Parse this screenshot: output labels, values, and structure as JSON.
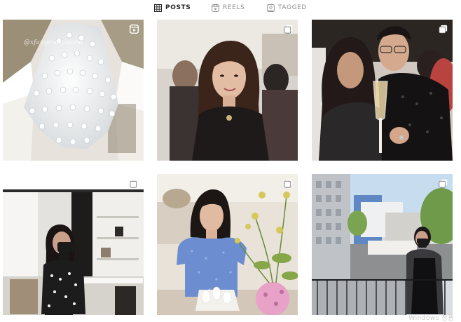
{
  "tabs": [
    {
      "label": "POSTS",
      "icon": "grid-icon",
      "active": true
    },
    {
      "label": "REELS",
      "icon": "reels-icon",
      "active": false
    },
    {
      "label": "TAGGED",
      "icon": "tagged-icon",
      "active": false
    }
  ],
  "posts": [
    {
      "type": "reel",
      "badge_icon": "reels-icon",
      "scene": "crystal chandelier"
    },
    {
      "type": "carousel",
      "badge_icon": "carousel-icon",
      "scene": "woman at event"
    },
    {
      "type": "carousel",
      "badge_icon": "carousel-icon",
      "scene": "couple with champagne"
    },
    {
      "type": "carousel",
      "badge_icon": "carousel-icon",
      "scene": "boutique mirror selfie"
    },
    {
      "type": "carousel",
      "badge_icon": "carousel-icon",
      "scene": "woman in blue dress with flowers"
    },
    {
      "type": "carousel",
      "badge_icon": "carousel-icon",
      "scene": "balcony city view"
    }
  ],
  "watermark": "@xfangusdiamond",
  "system_watermark": "Windows 정품",
  "colors": {
    "active_tab": "#262626",
    "inactive_tab": "#8e8e8e",
    "background": "#ffffff"
  }
}
